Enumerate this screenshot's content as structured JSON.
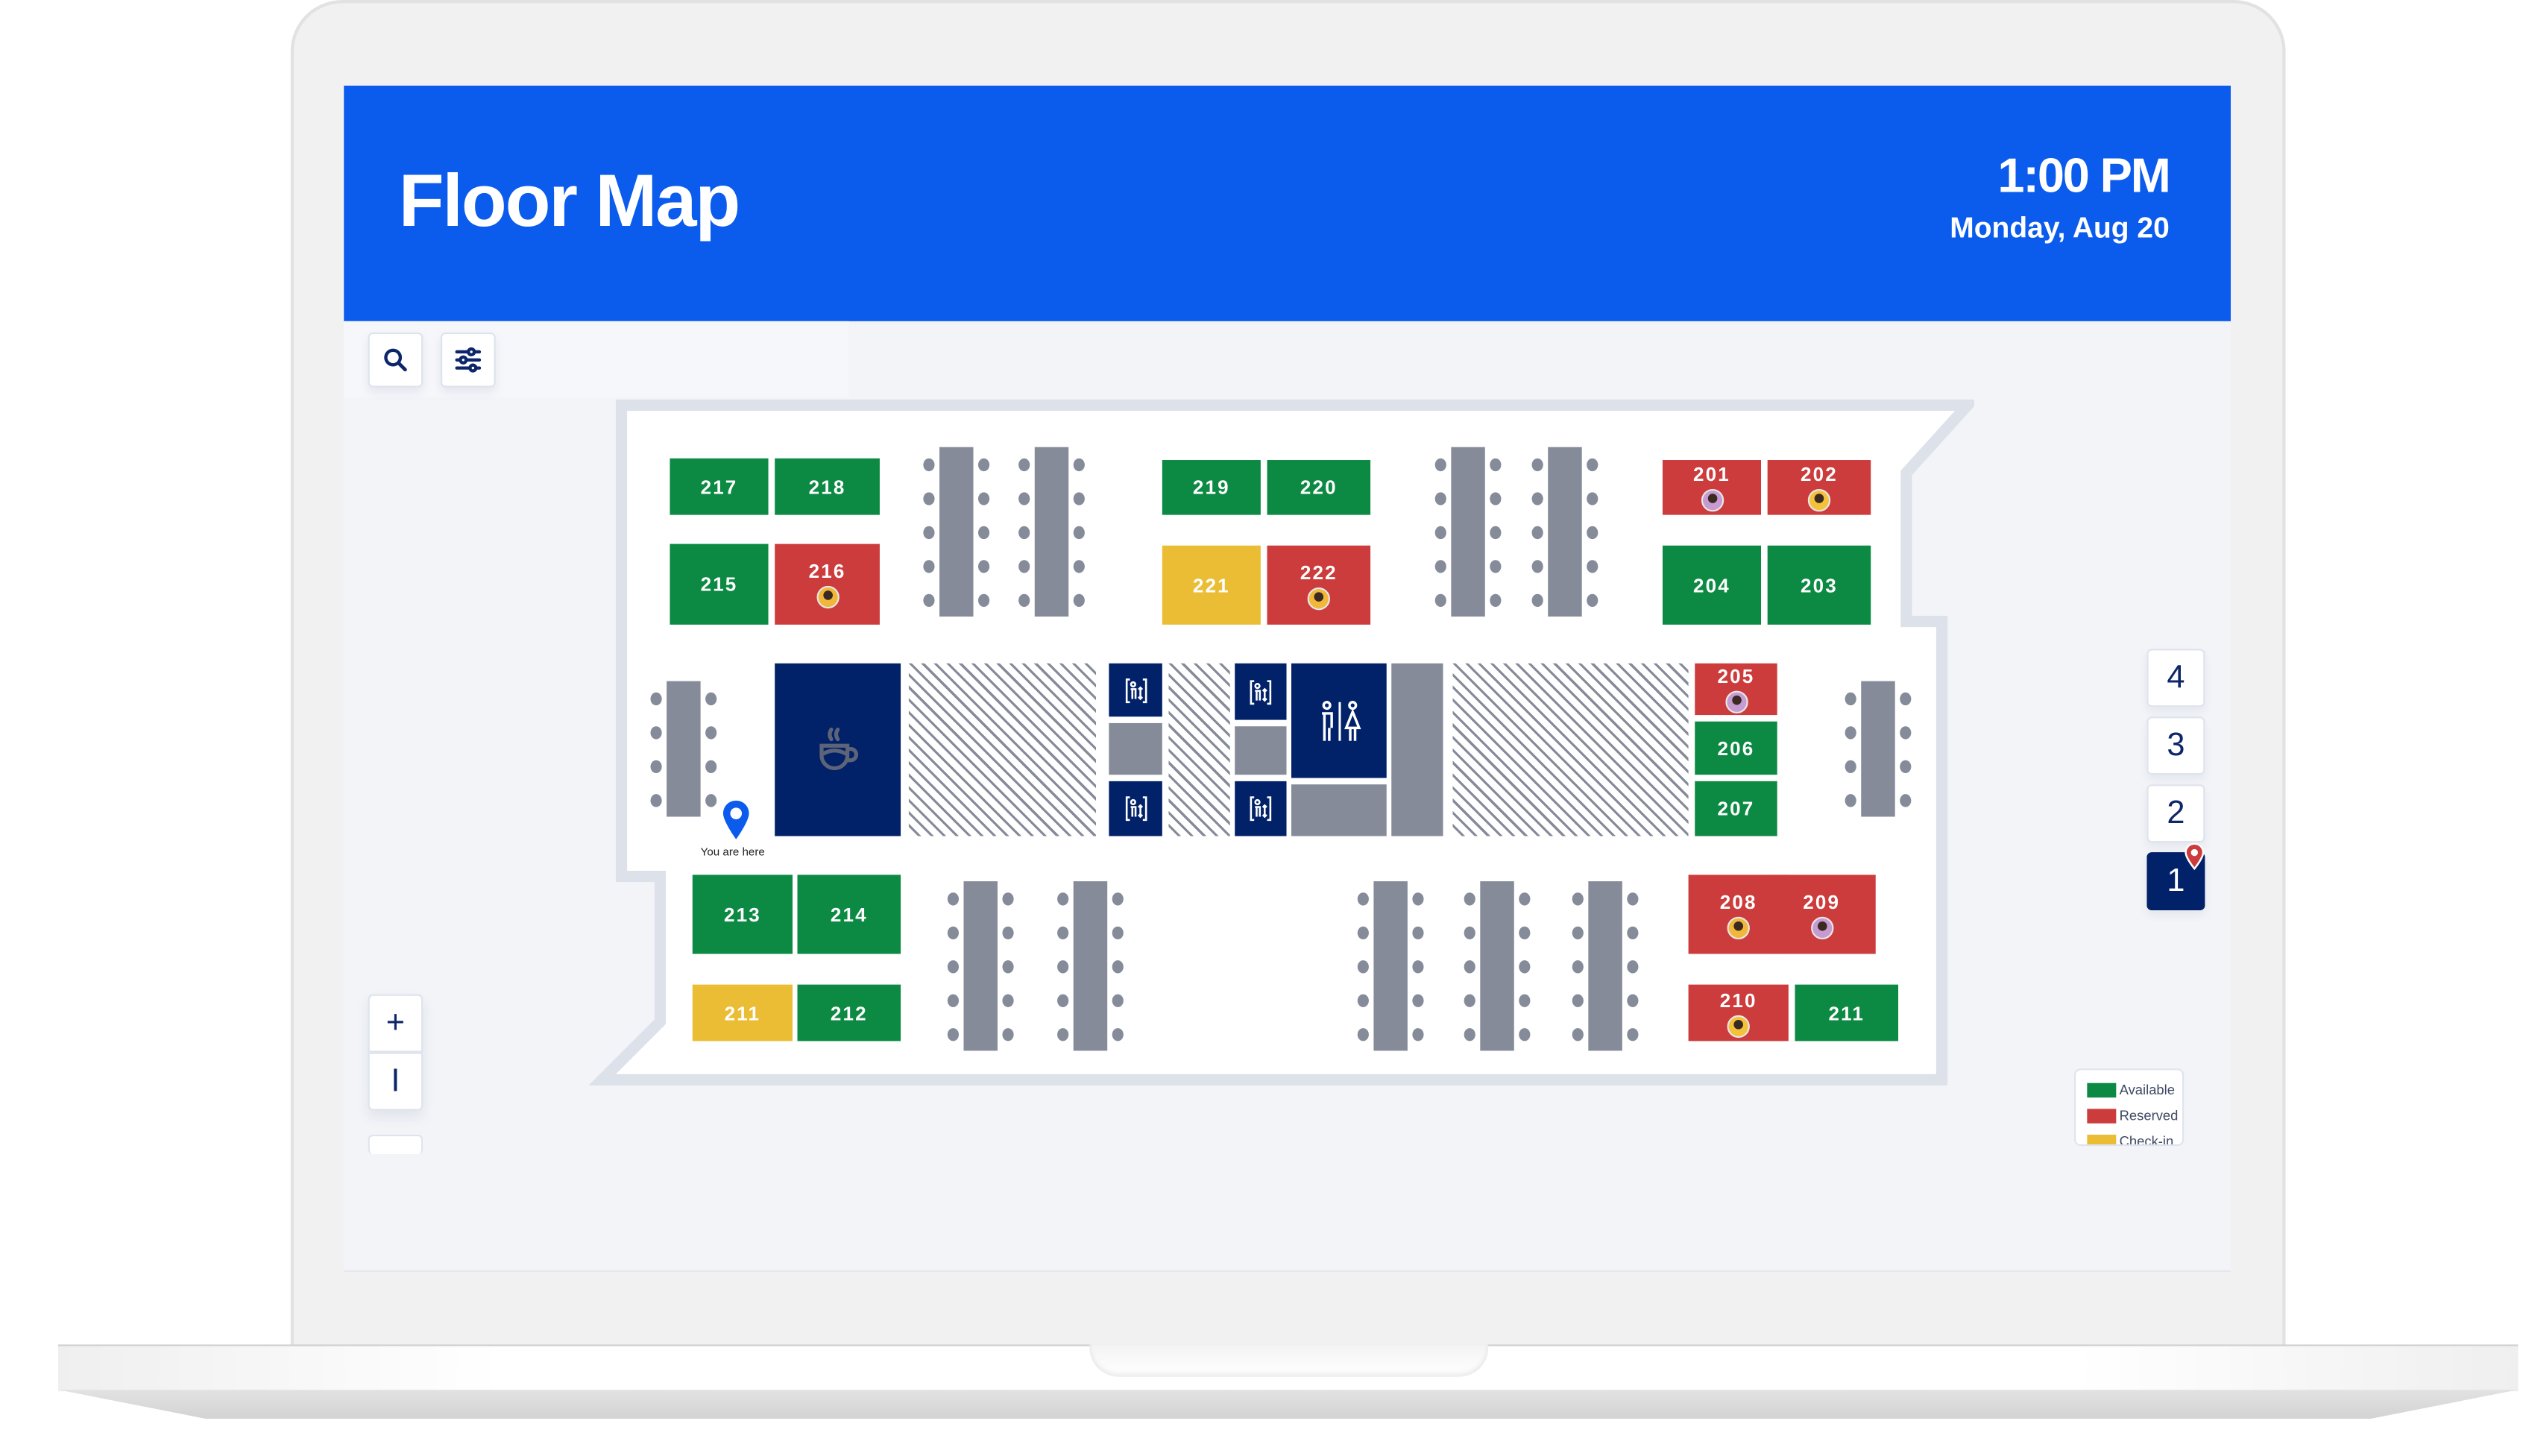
{
  "header": {
    "title": "Floor Map",
    "time": "1:00 PM",
    "date": "Monday, Aug 20"
  },
  "toolbar": {
    "search_icon": "search-icon",
    "filter_icon": "sliders-icon"
  },
  "colors": {
    "brand": "#0b5ced",
    "navy": "#012169",
    "available": "#0c8a43",
    "reserved": "#cd3c3c",
    "checkin": "#ebbd35",
    "furniture": "#868b9a"
  },
  "rooms": [
    {
      "id": "217",
      "status": "available",
      "occupied": false
    },
    {
      "id": "218",
      "status": "available",
      "occupied": false
    },
    {
      "id": "215",
      "status": "available",
      "occupied": false
    },
    {
      "id": "216",
      "status": "reserved",
      "occupied": true
    },
    {
      "id": "219",
      "status": "available",
      "occupied": false
    },
    {
      "id": "220",
      "status": "available",
      "occupied": false
    },
    {
      "id": "221",
      "status": "checkin",
      "occupied": false
    },
    {
      "id": "222",
      "status": "reserved",
      "occupied": true
    },
    {
      "id": "201",
      "status": "reserved",
      "occupied": true
    },
    {
      "id": "202",
      "status": "reserved",
      "occupied": true
    },
    {
      "id": "204",
      "status": "available",
      "occupied": false
    },
    {
      "id": "203",
      "status": "available",
      "occupied": false
    },
    {
      "id": "205",
      "status": "reserved",
      "occupied": true
    },
    {
      "id": "206",
      "status": "available",
      "occupied": false
    },
    {
      "id": "207",
      "status": "available",
      "occupied": false
    },
    {
      "id": "213",
      "status": "available",
      "occupied": false
    },
    {
      "id": "214",
      "status": "available",
      "occupied": false
    },
    {
      "id": "211",
      "status": "checkin",
      "occupied": false
    },
    {
      "id": "212",
      "status": "available",
      "occupied": false
    },
    {
      "id": "208",
      "status": "reserved",
      "occupied": true
    },
    {
      "id": "209",
      "status": "reserved",
      "occupied": true
    },
    {
      "id": "210",
      "status": "reserved",
      "occupied": true
    },
    {
      "id": "211",
      "status": "available",
      "occupied": false
    }
  ],
  "amenities": {
    "cafe_icon": "coffee-cup-icon",
    "elevator_icon": "elevator-icon",
    "restroom_icon": "restroom-icon"
  },
  "location_marker": {
    "label": "You are here"
  },
  "floors": {
    "items": [
      "4",
      "3",
      "2",
      "1"
    ],
    "active": "1"
  },
  "zoom": {
    "in_label": "+",
    "out_label": "I"
  },
  "legend": {
    "items": [
      {
        "label": "Available",
        "status": "available"
      },
      {
        "label": "Reserved",
        "status": "reserved"
      },
      {
        "label": "Check-in",
        "status": "checkin"
      }
    ]
  }
}
